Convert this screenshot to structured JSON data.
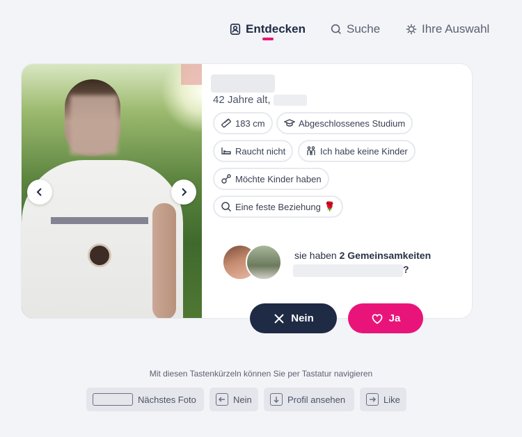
{
  "nav": {
    "discover": "Entdecken",
    "search": "Suche",
    "selection": "Ihre Auswahl"
  },
  "profile": {
    "age": "42 Jahre alt,",
    "tags": [
      {
        "label": "183 cm",
        "icon": "ruler-icon"
      },
      {
        "label": "Abgeschlossenes Studium",
        "icon": "graduation-cap-icon"
      },
      {
        "label": "Raucht nicht",
        "icon": "no-smoking-icon"
      },
      {
        "label": "Ich habe keine Kinder",
        "icon": "family-icon"
      },
      {
        "label": "Möchte Kinder haben",
        "icon": "pacifier-icon"
      },
      {
        "label": "Eine feste Beziehung",
        "icon": "search-icon",
        "emoji": "🌹"
      }
    ]
  },
  "commonalities": {
    "prefix": "sie haben ",
    "count_text": "2 Gemeinsamkeiten",
    "suffix": "?"
  },
  "actions": {
    "no": "Nein",
    "yes": "Ja"
  },
  "shortcuts": {
    "hint": "Mit diesen Tastenkürzeln können Sie per Tastatur navigieren",
    "next_photo": "Nächstes Foto",
    "no": "Nein",
    "view_profile": "Profil ansehen",
    "like": "Like"
  },
  "colors": {
    "accent": "#e8147a",
    "primary": "#1f2a44"
  }
}
